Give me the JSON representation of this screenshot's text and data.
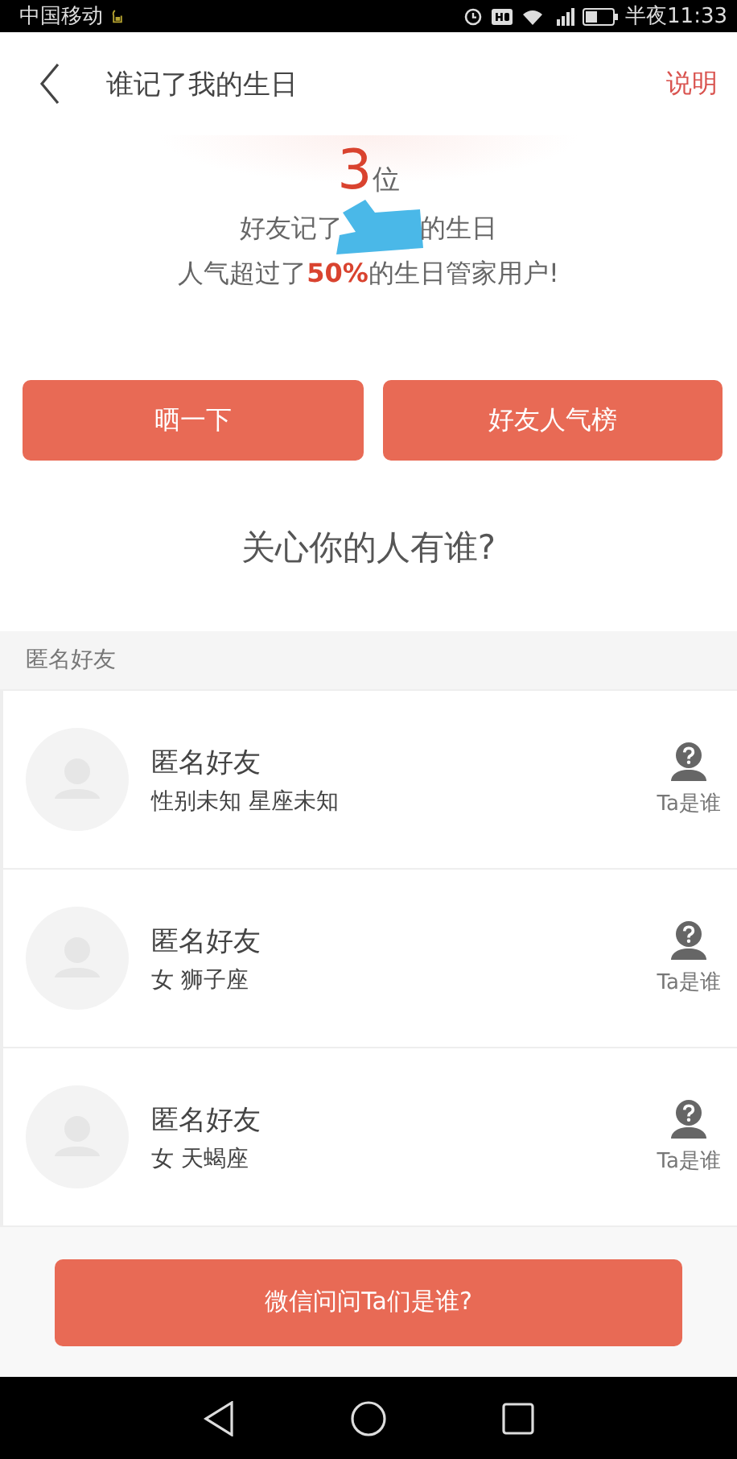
{
  "status_bar": {
    "carrier": "中国移动",
    "time": "半夜11:33"
  },
  "header": {
    "title": "谁记了我的生日",
    "action": "说明"
  },
  "summary": {
    "count": "3",
    "unit": "位",
    "line_before_mark": "好友记了",
    "line_after_mark": "的生日",
    "popularity": "人气超过了**50%**的生日管家用户!"
  },
  "buttons": [
    "晒一下",
    "好友人气榜"
  ],
  "heading": "关心你的人有谁?",
  "section_label": "匿名好友",
  "friends": [
    {
      "name": "匿名好友",
      "details": "性别未知 星座未知",
      "action": "Ta是谁"
    },
    {
      "name": "匿名好友",
      "details": "女 狮子座",
      "action": "Ta是谁"
    },
    {
      "name": "匿名好友",
      "details": "女 天蝎座",
      "action": "Ta是谁"
    }
  ],
  "bottom_button": "微信问问Ta们是谁?"
}
